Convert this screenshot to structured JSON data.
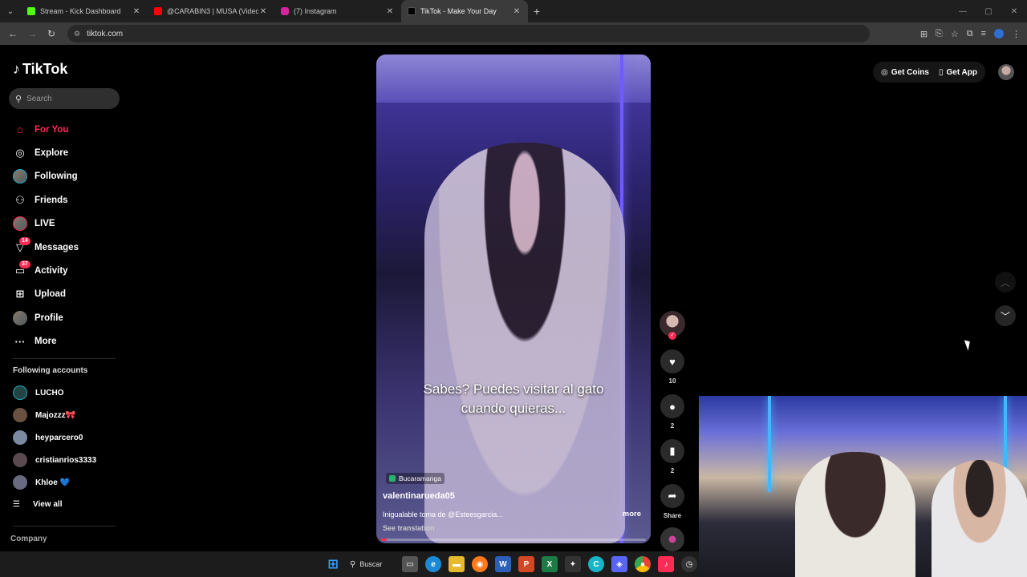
{
  "browser": {
    "tabs": [
      {
        "label": "Stream - Kick Dashboard",
        "color": "#53fc18"
      },
      {
        "label": "@CARABIN3 | MUSA (Video O",
        "color": "#ff0000"
      },
      {
        "label": "(7) Instagram",
        "color": "#d6249f"
      },
      {
        "label": "TikTok - Make Your Day",
        "color": "#000000"
      }
    ],
    "url": "tiktok.com"
  },
  "sidebar": {
    "logo": "TikTok",
    "search_placeholder": "Search",
    "nav": [
      {
        "label": "For You",
        "icon": "home-icon"
      },
      {
        "label": "Explore",
        "icon": "compass-icon"
      },
      {
        "label": "Following",
        "icon": "avatar-icon"
      },
      {
        "label": "Friends",
        "icon": "friends-icon"
      },
      {
        "label": "LIVE",
        "icon": "live-icon"
      },
      {
        "label": "Messages",
        "icon": "send-icon",
        "badge": "14"
      },
      {
        "label": "Activity",
        "icon": "inbox-icon",
        "badge": "37"
      },
      {
        "label": "Upload",
        "icon": "plus-square-icon"
      },
      {
        "label": "Profile",
        "icon": "profile-avatar-icon"
      },
      {
        "label": "More",
        "icon": "ellipsis-icon"
      }
    ],
    "following_title": "Following accounts",
    "following": [
      {
        "name": "LUCHO"
      },
      {
        "name": "Majozzz🎀"
      },
      {
        "name": "heyparcero0"
      },
      {
        "name": "cristianrios3333"
      },
      {
        "name": "Khloe 💙"
      }
    ],
    "view_all": "View all",
    "company": "Company"
  },
  "video": {
    "caption_line1": "Sabes? Puedes visitar al gato",
    "caption_line2": "cuando quieras...",
    "location": "Bucaramanga",
    "username": "valentinarueda05",
    "description": "Inigualable toma de @Esteesgarcia...",
    "more": "more",
    "see_translation": "See translation",
    "progress": 0.02
  },
  "actions": {
    "likes": "10",
    "comments": "2",
    "saves": "2",
    "share": "Share"
  },
  "topbar": {
    "get_coins": "Get Coins",
    "get_app": "Get App"
  },
  "taskbar": {
    "search": "Buscar"
  }
}
